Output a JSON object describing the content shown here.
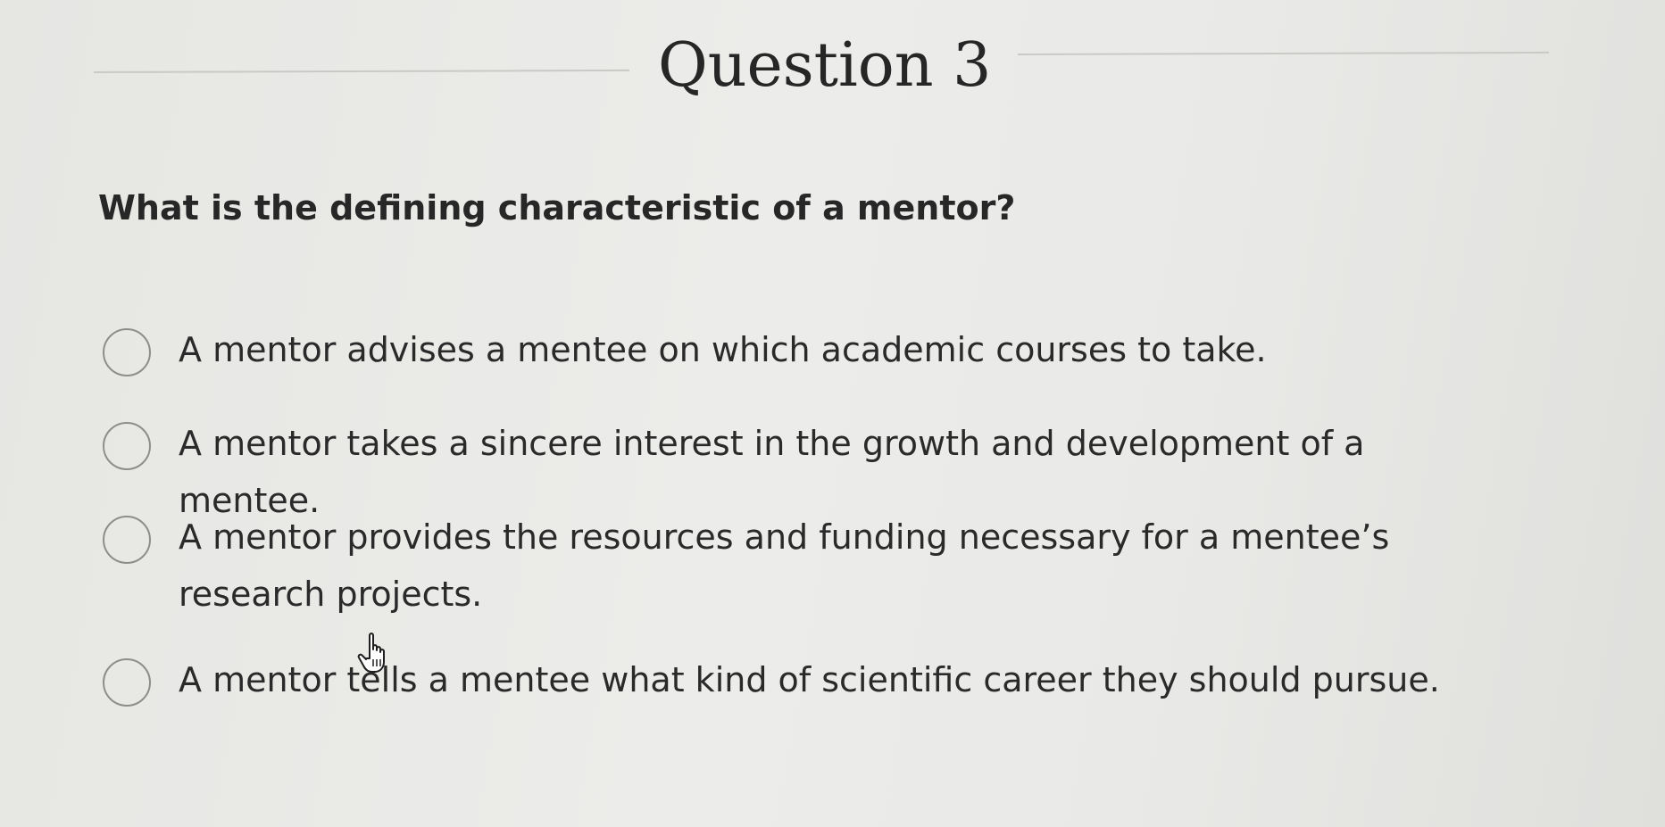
{
  "header": {
    "title": "Question 3"
  },
  "question": {
    "prompt": "What is the defining characteristic of a mentor?"
  },
  "options": [
    {
      "label": "A mentor advises a mentee on which academic courses to take.",
      "selected": false
    },
    {
      "label": "A mentor takes a sincere interest in the growth and development of a mentee.",
      "selected": false
    },
    {
      "label": "A mentor provides the resources and funding necessary for a mentee’s research projects.",
      "selected": false
    },
    {
      "label": "A mentor tells a mentee what kind of scientific career they should pursue.",
      "selected": false
    }
  ],
  "cursor": {
    "icon": "hand-pointer-icon"
  }
}
